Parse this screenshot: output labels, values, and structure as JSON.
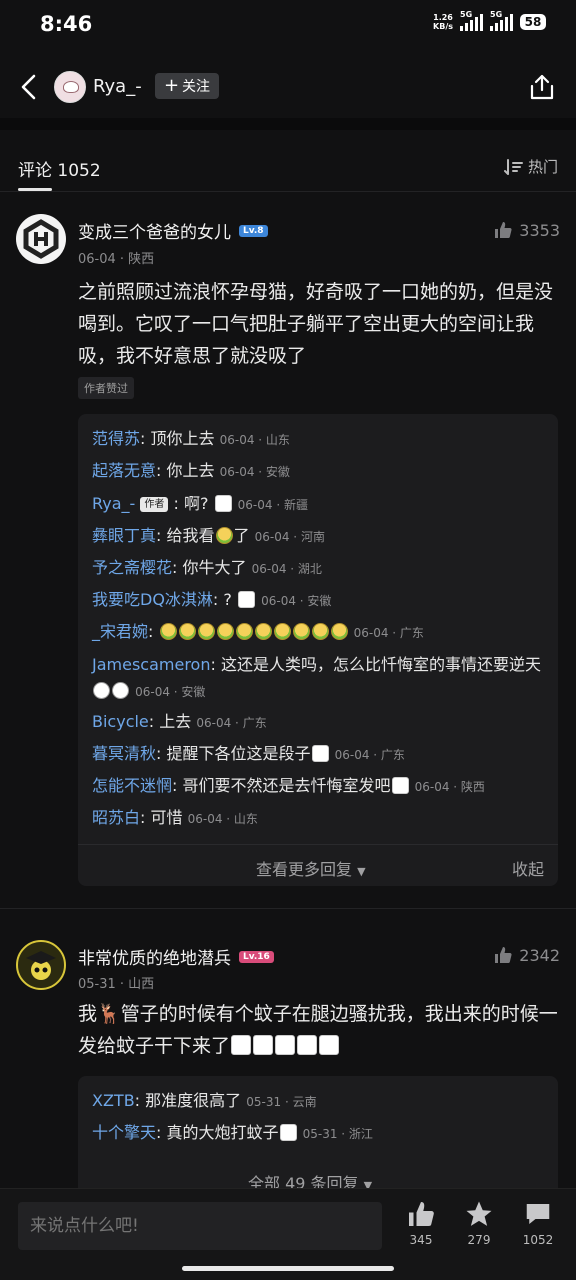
{
  "status": {
    "time": "8:46",
    "speed_top": "1.26",
    "speed_bottom": "KB/s",
    "sig1": "5G",
    "sig2": "5G",
    "battery": "58"
  },
  "header": {
    "username": "Rya_-",
    "follow_label": "关注"
  },
  "tabs": {
    "title": "评论 1052",
    "sort_label": "热门"
  },
  "comments": [
    {
      "name": "变成三个爸爸的女儿",
      "level": "Lv.8",
      "meta": "06-04 · 陕西",
      "likes": "3353",
      "text": "之前照顾过流浪怀孕母猫，好奇吸了一口她的奶，但是没喝到。它叹了一口气把肚子躺平了空出更大的空间让我吸，我不好意思了就没吸了",
      "tag": "作者赞过",
      "replies": [
        {
          "name": "范得苏",
          "text": "顶你上去",
          "meta": "06-04 · 山东"
        },
        {
          "name": "起落无意",
          "text": "你上去",
          "meta": "06-04 · 安徽"
        },
        {
          "name": "Rya_-",
          "badge": "作者",
          "text": "啊?",
          "meta": "06-04 · 新疆"
        },
        {
          "name": "彝眼丁真",
          "text": "给我看",
          "text2": "了",
          "meta": "06-04 · 河南"
        },
        {
          "name": "予之斋樱花",
          "text": "你牛大了",
          "meta": "06-04 · 湖北"
        },
        {
          "name": "我要吃DQ冰淇淋",
          "text": "?",
          "meta": "06-04 · 安徽"
        },
        {
          "name": "_宋君婉",
          "text": "",
          "meta": "06-04 · 广东"
        },
        {
          "name": "Jamescameron",
          "text": "这还是人类吗，怎么比忏悔室的事情还要逆天",
          "meta": "06-04 · 安徽"
        },
        {
          "name": "Bicycle",
          "text": "上去",
          "meta": "06-04 · 广东"
        },
        {
          "name": "暮冥清秋",
          "text": "提醒下各位这是段子",
          "meta": "06-04 · 广东"
        },
        {
          "name": "怎能不迷惘",
          "text": "哥们要不然还是去忏悔室发吧",
          "meta": "06-04 · 陕西"
        },
        {
          "name": "昭苏白",
          "text": "可惜",
          "meta": "06-04 · 山东"
        }
      ],
      "more_label": "查看更多回复",
      "fold_label": "收起"
    },
    {
      "name": "非常优质的绝地潜兵",
      "level": "Lv.16",
      "meta": "05-31 · 山西",
      "likes": "2342",
      "text_a": "我",
      "text_b": "管子的时候有个蚊子在腿边骚扰我，我出来的时候一发给蚊子干下来了",
      "replies": [
        {
          "name": "XZTB",
          "text": "那准度很高了",
          "meta": "05-31 · 云南"
        },
        {
          "name": "十个擎天",
          "text": "真的大炮打蚊子",
          "meta": "05-31 · 浙江"
        }
      ],
      "more_label": "全部 49 条回复"
    }
  ],
  "bottom": {
    "placeholder": "来说点什么吧!",
    "likes": "345",
    "stars": "279",
    "comments": "1052"
  },
  "colors": {
    "accent_blue": "#6fa7e8",
    "lv8": "#3d86d9",
    "lv16": "#d94c7a"
  }
}
